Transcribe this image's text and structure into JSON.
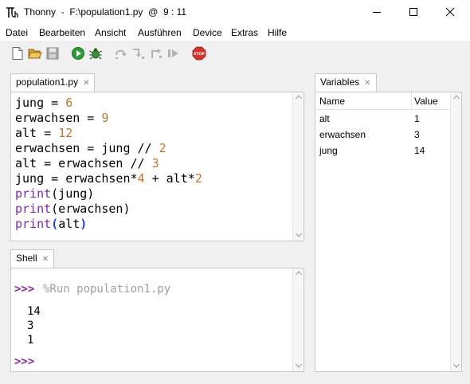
{
  "window": {
    "title": "Thonny  -  F:\\population1.py  @  9 : 11"
  },
  "menu": [
    "Datei",
    "Bearbeiten",
    "Ansicht",
    "Ausführen",
    "Device",
    "Extras",
    "Hilfe"
  ],
  "toolbar": [
    "new-file",
    "open-file",
    "save-file",
    "run",
    "debug",
    "step-over",
    "step-into",
    "step-out",
    "resume",
    "stop"
  ],
  "editor": {
    "tab_label": "population1.py",
    "lines": [
      [
        {
          "t": "jung = "
        },
        {
          "t": "6",
          "c": "num"
        }
      ],
      [
        {
          "t": "erwachsen = "
        },
        {
          "t": "9",
          "c": "num"
        }
      ],
      [
        {
          "t": "alt = "
        },
        {
          "t": "12",
          "c": "num"
        }
      ],
      [
        {
          "t": "erwachsen = jung // "
        },
        {
          "t": "2",
          "c": "num"
        }
      ],
      [
        {
          "t": "alt = erwachsen // "
        },
        {
          "t": "3",
          "c": "num"
        }
      ],
      [
        {
          "t": "jung = erwachsen*"
        },
        {
          "t": "4",
          "c": "num"
        },
        {
          "t": " + alt*"
        },
        {
          "t": "2",
          "c": "num"
        }
      ],
      [
        {
          "t": "print",
          "c": "kw"
        },
        {
          "t": "(jung)"
        }
      ],
      [
        {
          "t": "print",
          "c": "kw"
        },
        {
          "t": "(erwachsen)"
        }
      ],
      [
        {
          "t": "print",
          "c": "kw"
        },
        {
          "t": "(",
          "c": "paren-hl"
        },
        {
          "t": "alt"
        },
        {
          "t": ")",
          "c": "paren-hl"
        }
      ]
    ]
  },
  "shell": {
    "tab_label": "Shell",
    "prompt": ">>>",
    "run_command": "%Run population1.py",
    "output": [
      "14",
      "3",
      "1"
    ]
  },
  "variables": {
    "tab_label": "Variables",
    "columns": [
      "Name",
      "Value"
    ],
    "rows": [
      {
        "name": "alt",
        "value": "1"
      },
      {
        "name": "erwachsen",
        "value": "3"
      },
      {
        "name": "jung",
        "value": "14"
      }
    ]
  },
  "colors": {
    "number": "#c0752e",
    "keyword": "#7a2aa5",
    "prompt": "#8a2aa0",
    "run_command": "#a0a0a0"
  }
}
